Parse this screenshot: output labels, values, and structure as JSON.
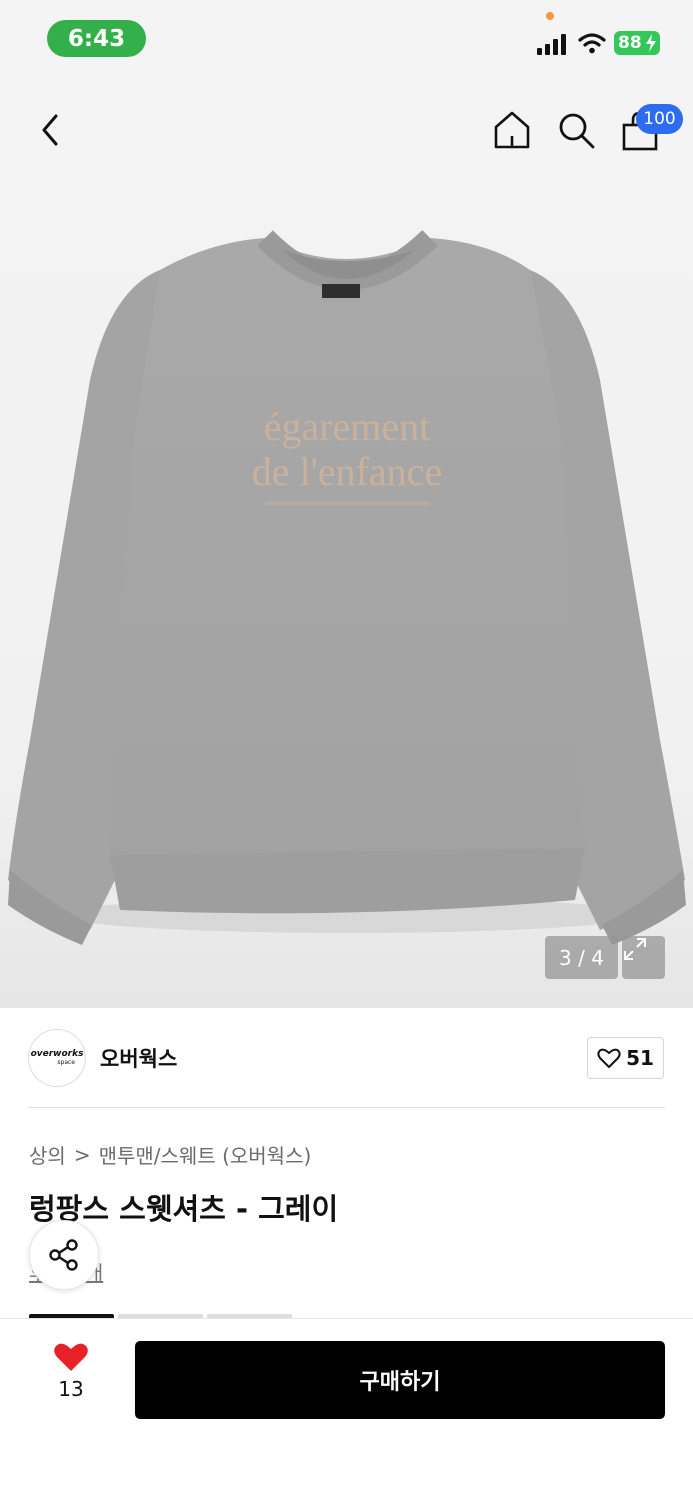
{
  "status_bar": {
    "time": "6:43",
    "battery_level": "88"
  },
  "nav": {
    "cart_count": "100"
  },
  "product_image": {
    "print_line1": "égarement",
    "print_line2": "de l'enfance",
    "counter": "3 / 4"
  },
  "brand": {
    "logo_text_main": "overworks",
    "logo_text_sub": "space",
    "name": "오버웍스",
    "like_count": "51"
  },
  "details": {
    "breadcrumb_parent": "상의",
    "breadcrumb_separator": ">",
    "breadcrumb_child": "맨투맨/스웨트 (오버웍스)",
    "title": "렁팡스 스웻셔츠 - 그레이",
    "review_text": "후기 3개"
  },
  "bottom_bar": {
    "wish_count": "13",
    "buy_label": "구매하기"
  },
  "colors": {
    "status_pill": "#34b04a",
    "battery": "#34c759",
    "badge": "#2d6cf0",
    "heart": "#e8202a",
    "buy_button": "#000000"
  }
}
